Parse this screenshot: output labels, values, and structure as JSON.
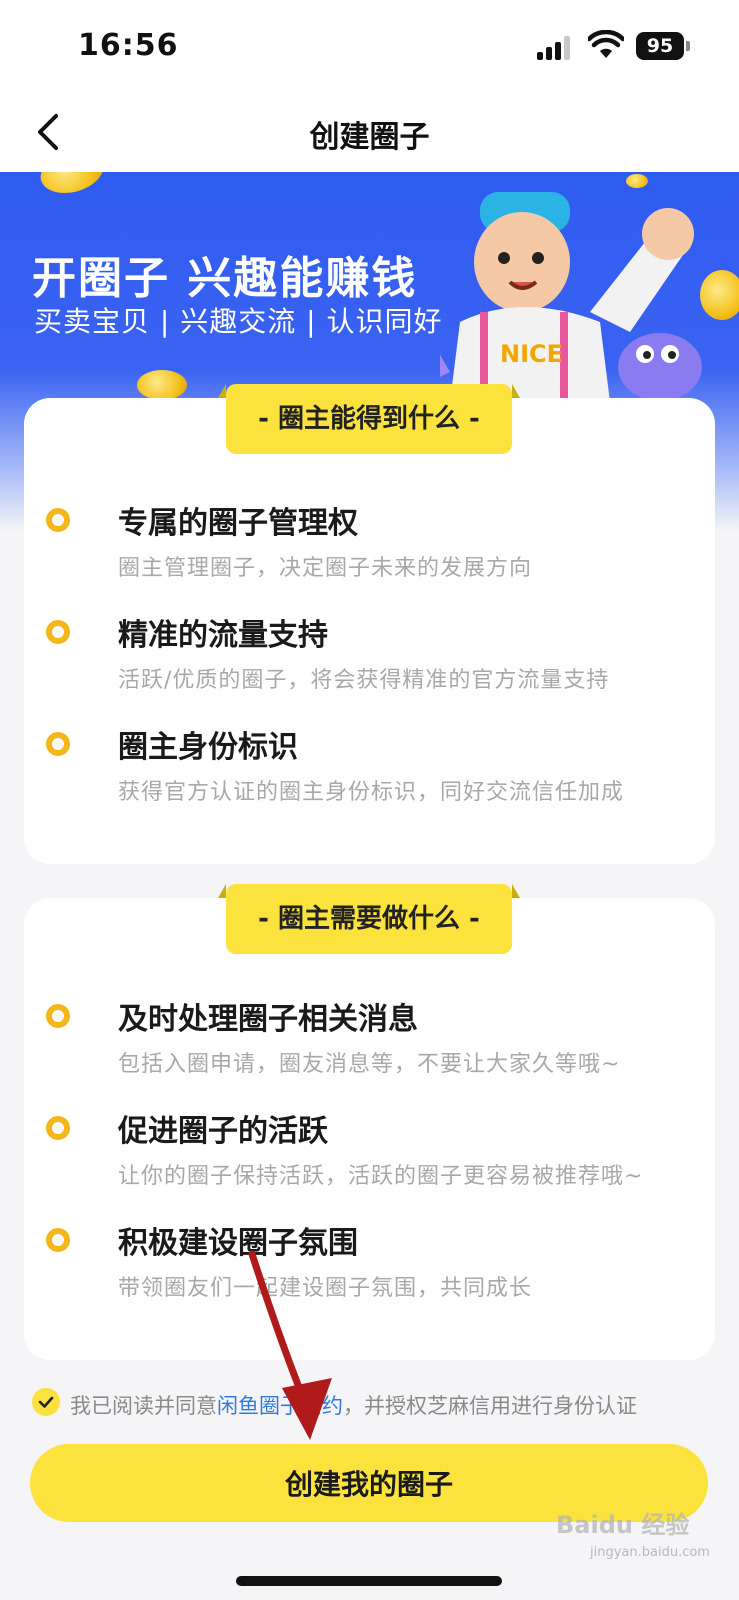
{
  "status_bar": {
    "time": "16:56",
    "battery": "95"
  },
  "nav": {
    "title": "创建圈子"
  },
  "banner": {
    "title": "开圈子 兴趣能赚钱",
    "subtitle": "买卖宝贝 | 兴趣交流 | 认识同好",
    "mascot_shirt_text": "XIANYU NICE"
  },
  "benefits": {
    "heading": "- 圈主能得到什么 -",
    "items": [
      {
        "title": "专属的圈子管理权",
        "desc": "圈主管理圈子，决定圈子未来的发展方向"
      },
      {
        "title": "精准的流量支持",
        "desc": "活跃/优质的圈子，将会获得精准的官方流量支持"
      },
      {
        "title": "圈主身份标识",
        "desc": "获得官方认证的圈主身份标识，同好交流信任加成"
      }
    ]
  },
  "duties": {
    "heading": "- 圈主需要做什么 -",
    "items": [
      {
        "title": "及时处理圈子相关消息",
        "desc": "包括入圈申请，圈友消息等，不要让大家久等哦~"
      },
      {
        "title": "促进圈子的活跃",
        "desc": "让你的圈子保持活跃，活跃的圈子更容易被推荐哦~"
      },
      {
        "title": "积极建设圈子氛围",
        "desc": "带领圈友们一起建设圈子氛围，共同成长"
      }
    ]
  },
  "agreement": {
    "prefix": "我已阅读并同意",
    "link": "闲鱼圈子公约",
    "suffix": "，并授权芝麻信用进行身份认证",
    "checked": true
  },
  "create_button": "创建我的圈子",
  "watermark": {
    "main": "Baidu 经验",
    "sub": "jingyan.baidu.com"
  },
  "colors": {
    "accent_yellow": "#fbe23d",
    "bullet_orange": "#f3b71a",
    "banner_blue": "#2e5bf0",
    "link_blue": "#2d7be0",
    "annotation_red": "#b01a1a"
  }
}
